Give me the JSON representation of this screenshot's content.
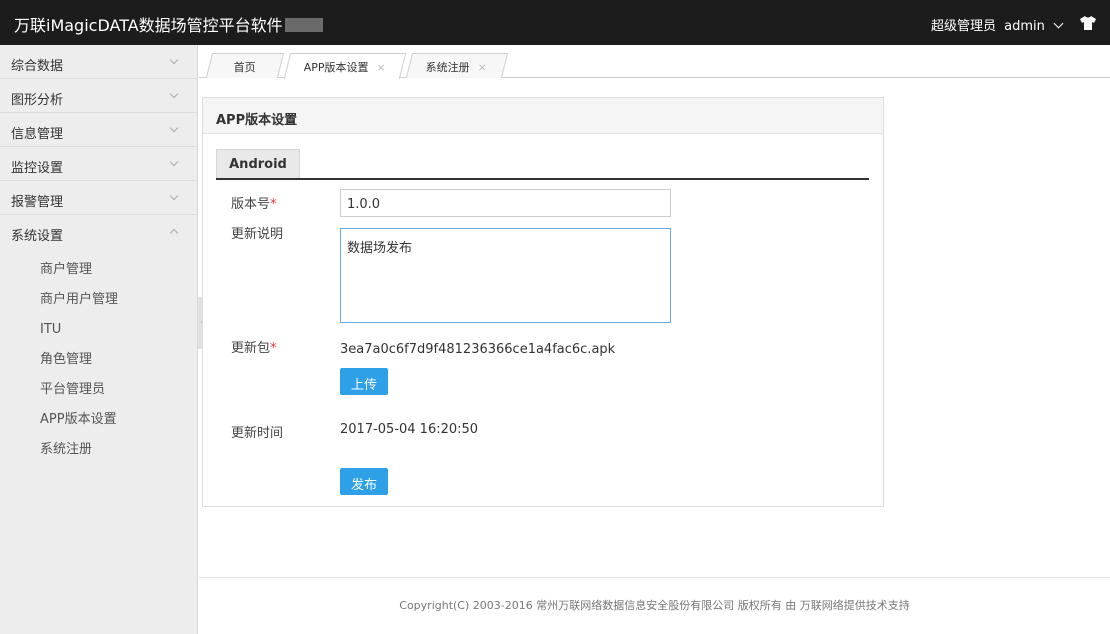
{
  "header": {
    "app_title": "万联iMagicDATA数据场管控平台软件",
    "role": "超级管理员",
    "username": "admin",
    "user_icon": "chevron-down-icon",
    "extra_icon": "shirt-icon"
  },
  "sidebar": {
    "groups": [
      {
        "label": "综合数据",
        "expanded": false
      },
      {
        "label": "图形分析",
        "expanded": false
      },
      {
        "label": "信息管理",
        "expanded": false
      },
      {
        "label": "监控设置",
        "expanded": false
      },
      {
        "label": "报警管理",
        "expanded": false
      },
      {
        "label": "系统设置",
        "expanded": true
      }
    ],
    "sub_items": [
      "商户管理",
      "商户用户管理",
      "ITU",
      "角色管理",
      "平台管理员",
      "APP版本设置",
      "系统注册"
    ]
  },
  "tabs": [
    {
      "label": "首页",
      "closable": false
    },
    {
      "label": "APP版本设置",
      "closable": true,
      "active": true
    },
    {
      "label": "系统注册",
      "closable": true
    }
  ],
  "tab_close_glyph": "×",
  "panel": {
    "title": "APP版本设置",
    "platform_tab": "Android",
    "required_mark": "*",
    "version_label": "版本号",
    "version_value": "1.0.0",
    "notes_label": "更新说明",
    "notes_value": "数据场发布",
    "package_label": "更新包",
    "package_file": "3ea7a0c6f7d9f481236366ce1a4fac6c.apk",
    "upload_button": "上传",
    "time_label": "更新时间",
    "time_value": "2017-05-04 16:20:50",
    "publish_button": "发布"
  },
  "footer": {
    "copyright": "Copyright(C) 2003-2016 常州万联网络数据信息安全股份有限公司 版权所有 由 万联网络提供技术支持"
  },
  "colors": {
    "header_bg": "#1c1c1c",
    "accent_button": "#2ea0e8",
    "required": "#e33333"
  }
}
